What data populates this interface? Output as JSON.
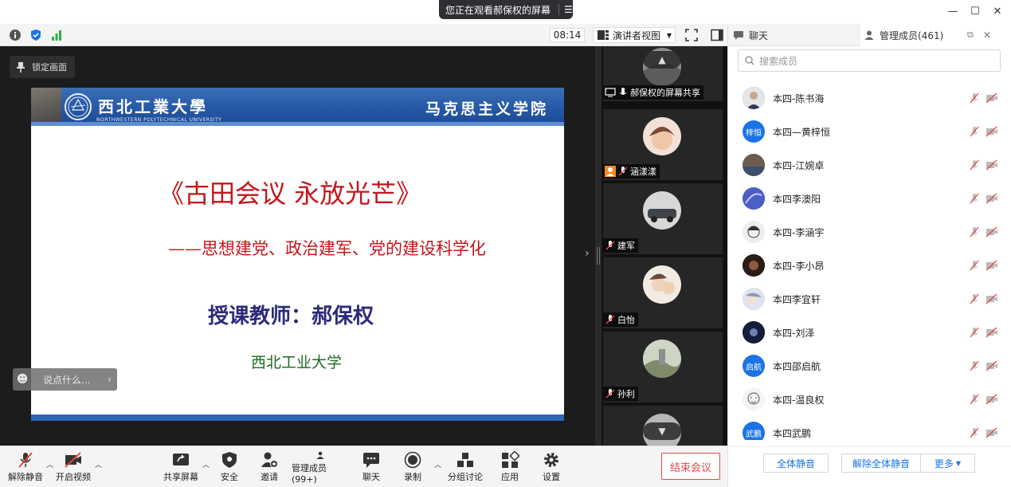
{
  "banner": {
    "text": "您正在观看郝保权的屏幕"
  },
  "infobar": {
    "clock": "08:14",
    "view_label": "演讲者视图"
  },
  "stage": {
    "lock_label": "锁定画面",
    "chat_placeholder": "说点什么..."
  },
  "slide": {
    "uni_cn": "西北工業大學",
    "uni_en": "NORTHWESTERN POLYTECHNICAL UNIVERSITY",
    "school": "马克思主义学院",
    "title": "《古田会议  永放光芒》",
    "subtitle": "——思想建党、政治建军、党的建设科学化",
    "teacher": "授课教师：郝保权",
    "university": "西北工业大学"
  },
  "videos": [
    {
      "name": "郝保权的屏幕共享",
      "avatar_color": "#8c8c8c"
    },
    {
      "name": "涵漾漾",
      "avatar_color": "#e9b9a4"
    },
    {
      "name": "建军",
      "avatar_color": "#4a4f55"
    },
    {
      "name": "白怡",
      "avatar_color": "#e8d7c4"
    },
    {
      "name": "孙利",
      "avatar_color": "#9aa48a"
    }
  ],
  "panel": {
    "tab_chat": "聊天",
    "tab_members": "管理成员(461)",
    "search_placeholder": "搜索成员",
    "members": [
      {
        "name": "本四-陈书海",
        "avatar_text": "",
        "color": "#3b4a63"
      },
      {
        "name": "本四—黄梓恒",
        "avatar_text": "梓恒",
        "color": "#1a73e8"
      },
      {
        "name": "本四-江婉卓",
        "avatar_text": "",
        "color": "#6a5d4f"
      },
      {
        "name": "本四李澳阳",
        "avatar_text": "",
        "color": "#5a6fd6"
      },
      {
        "name": "本四-李涵宇",
        "avatar_text": "",
        "color": "#c7c7c7"
      },
      {
        "name": "本四-李小昂",
        "avatar_text": "",
        "color": "#3a2a22"
      },
      {
        "name": "本四李宜轩",
        "avatar_text": "",
        "color": "#b9c3d6"
      },
      {
        "name": "本四-刘泽",
        "avatar_text": "",
        "color": "#1d2a4d"
      },
      {
        "name": "本四邵启航",
        "avatar_text": "启航",
        "color": "#1a73e8"
      },
      {
        "name": "本四-温良权",
        "avatar_text": "",
        "color": "#e6e6e6"
      },
      {
        "name": "本四武鹏",
        "avatar_text": "武鹏",
        "color": "#1a73e8"
      }
    ],
    "mute_all": "全体静音",
    "unmute_all": "解除全体静音",
    "more": "更多"
  },
  "toolbar": {
    "unmute": "解除静音",
    "start_video": "开启视频",
    "share_screen": "共享屏幕",
    "security": "安全",
    "invite": "邀请",
    "members": "管理成员(99+)",
    "chat": "聊天",
    "record": "录制",
    "breakout": "分组讨论",
    "apps": "应用",
    "settings": "设置",
    "end_meeting": "结束会议"
  },
  "colors": {
    "accent": "#1a73e8",
    "danger": "#e04848",
    "slide_red": "#c4161c",
    "slide_blue": "#2456a4"
  }
}
